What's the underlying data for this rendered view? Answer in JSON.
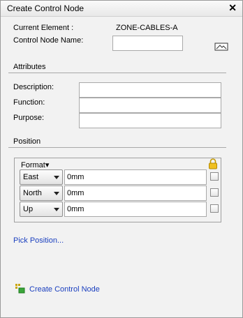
{
  "window": {
    "title": "Create Control Node",
    "close_glyph": "✕"
  },
  "info": {
    "current_element_label": "Current Element  :",
    "current_element_value": "ZONE-CABLES-A",
    "control_node_name_label": "Control Node Name:",
    "control_node_name_value": ""
  },
  "attributes": {
    "heading": "Attributes",
    "description_label": "Description:",
    "function_label": "Function:",
    "purpose_label": "Purpose:",
    "description_value": "",
    "function_value": "",
    "purpose_value": ""
  },
  "position": {
    "heading": "Position",
    "format_label": "Format▾",
    "rows": [
      {
        "axis": "East",
        "value": "0mm"
      },
      {
        "axis": "North",
        "value": "0mm"
      },
      {
        "axis": "Up",
        "value": "0mm"
      }
    ]
  },
  "links": {
    "pick_position": "Pick Position...",
    "create_control_node": "Create Control Node"
  },
  "icons": {
    "close": "close-icon",
    "browse": "picture-icon",
    "lock": "lock-icon",
    "create": "node-create-icon"
  },
  "colors": {
    "link": "#1a3fbf",
    "panel_bg": "#f2f2f2",
    "lock": "#e6b400"
  }
}
